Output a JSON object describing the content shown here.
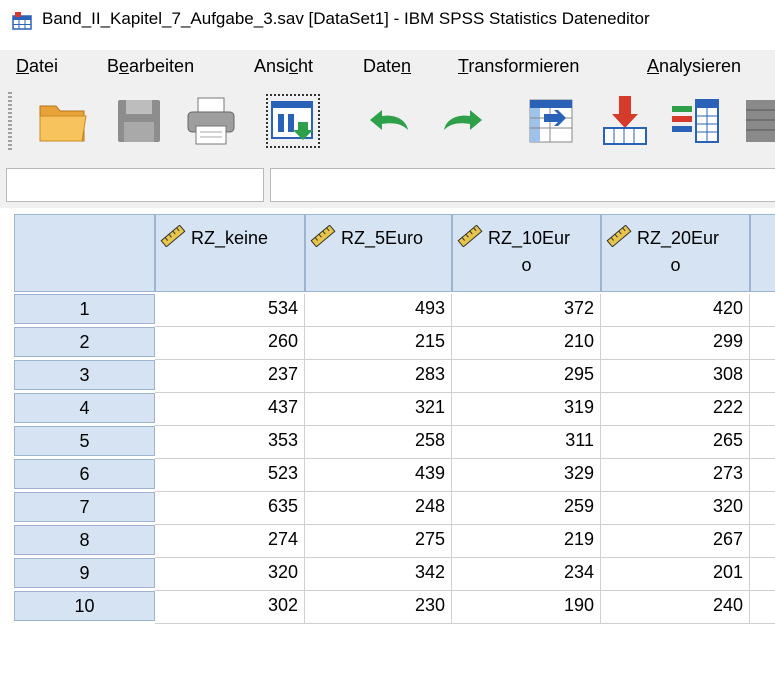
{
  "window": {
    "title": "Band_II_Kapitel_7_Aufgabe_3.sav [DataSet1] - IBM SPSS Statistics Dateneditor",
    "app_icon": "spss-dataeditor-icon"
  },
  "menu": [
    {
      "id": "datei",
      "pre": "",
      "ul": "D",
      "post": "atei"
    },
    {
      "id": "bearbeiten",
      "pre": "B",
      "ul": "e",
      "post": "arbeiten"
    },
    {
      "id": "ansicht",
      "pre": "Ansi",
      "ul": "c",
      "post": "ht"
    },
    {
      "id": "daten",
      "pre": "Date",
      "ul": "n",
      "post": ""
    },
    {
      "id": "transformieren",
      "pre": "",
      "ul": "T",
      "post": "ransformieren"
    },
    {
      "id": "analysieren",
      "pre": "",
      "ul": "A",
      "post": "nalysieren"
    }
  ],
  "toolbar": [
    {
      "name": "open-folder-icon"
    },
    {
      "name": "save-icon"
    },
    {
      "name": "print-icon"
    },
    {
      "name": "recall-dialog-icon"
    },
    {
      "name": "undo-icon"
    },
    {
      "name": "redo-icon"
    },
    {
      "name": "goto-case-icon"
    },
    {
      "name": "goto-variable-icon"
    },
    {
      "name": "variables-icon"
    }
  ],
  "cell_editor": {
    "reference": "",
    "value": ""
  },
  "table": {
    "columns": [
      {
        "name": "RZ_keine",
        "line1": "RZ_keine",
        "line2": ""
      },
      {
        "name": "RZ_5Euro",
        "line1": "RZ_5Euro",
        "line2": ""
      },
      {
        "name": "RZ_10Euro",
        "line1": "RZ_10Eur",
        "line2": "o"
      },
      {
        "name": "RZ_20Euro",
        "line1": "RZ_20Eur",
        "line2": "o"
      }
    ],
    "rows": [
      {
        "num": "1",
        "values": [
          "534",
          "493",
          "372",
          "420"
        ]
      },
      {
        "num": "2",
        "values": [
          "260",
          "215",
          "210",
          "299"
        ]
      },
      {
        "num": "3",
        "values": [
          "237",
          "283",
          "295",
          "308"
        ]
      },
      {
        "num": "4",
        "values": [
          "437",
          "321",
          "319",
          "222"
        ]
      },
      {
        "num": "5",
        "values": [
          "353",
          "258",
          "311",
          "265"
        ]
      },
      {
        "num": "6",
        "values": [
          "523",
          "439",
          "329",
          "273"
        ]
      },
      {
        "num": "7",
        "values": [
          "635",
          "248",
          "259",
          "320"
        ]
      },
      {
        "num": "8",
        "values": [
          "274",
          "275",
          "219",
          "267"
        ]
      },
      {
        "num": "9",
        "values": [
          "320",
          "342",
          "234",
          "201"
        ]
      },
      {
        "num": "10",
        "values": [
          "302",
          "230",
          "190",
          "240"
        ]
      }
    ]
  }
}
